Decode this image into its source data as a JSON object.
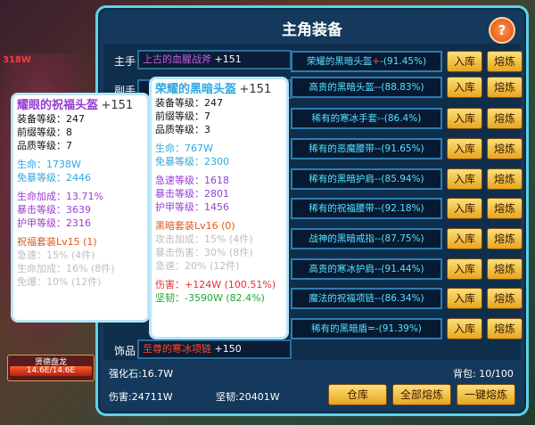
{
  "background": {
    "hp_label": "贤德盘龙",
    "hp_value": "14.6E/14.6E",
    "red_tag": "318W"
  },
  "panel": {
    "title": "主角装备",
    "help_icon": "?"
  },
  "slots": [
    {
      "label": "主手",
      "name": "上古的血腥战斧",
      "level": "+151",
      "color": "#c85ae6"
    },
    {
      "label": "副手",
      "name": "",
      "level": "",
      "color": "#c85ae6"
    },
    {
      "label": "饰品",
      "name": "至尊的寒冰项链",
      "level": "+150",
      "color": "#ff4a2a"
    }
  ],
  "bag": [
    {
      "name": "荣耀的黑暗头盔",
      "suffix": "+",
      "rate": "-(91.45%)",
      "color": "#57e0ff",
      "store": "入库",
      "smelt": "熔炼"
    },
    {
      "name": "高贵的黑暗头盔",
      "suffix": "",
      "rate": "--(88.83%)",
      "color": "#57e0ff",
      "store": "入库",
      "smelt": "熔炼"
    },
    {
      "name": "稀有的寒冰手套",
      "suffix": "",
      "rate": "--(86.4%)",
      "color": "#57e0ff",
      "store": "入库",
      "smelt": "熔炼"
    },
    {
      "name": "稀有的恶魔腰带",
      "suffix": "",
      "rate": "--(91.65%)",
      "color": "#57e0ff",
      "store": "入库",
      "smelt": "熔炼"
    },
    {
      "name": "稀有的黑暗护肩",
      "suffix": "",
      "rate": "--(85.94%)",
      "color": "#57e0ff",
      "store": "入库",
      "smelt": "熔炼"
    },
    {
      "name": "稀有的祝福腰带",
      "suffix": "",
      "rate": "--(92.18%)",
      "color": "#57e0ff",
      "store": "入库",
      "smelt": "熔炼"
    },
    {
      "name": "战神的黑暗戒指",
      "suffix": "",
      "rate": "--(87.75%)",
      "color": "#57e0ff",
      "store": "入库",
      "smelt": "熔炼"
    },
    {
      "name": "高贵的寒冰护肩",
      "suffix": "",
      "rate": "--(91.44%)",
      "color": "#57e0ff",
      "store": "入库",
      "smelt": "熔炼"
    },
    {
      "name": "魔法的祝福项链",
      "suffix": "",
      "rate": "--(86.34%)",
      "color": "#57e0ff",
      "store": "入库",
      "smelt": "熔炼"
    },
    {
      "name": "稀有的黑暗盾",
      "suffix": "",
      "rate": "=-(91.39%)",
      "color": "#57e0ff",
      "store": "入库",
      "smelt": "熔炼"
    }
  ],
  "footer": {
    "strengthen_stone": "强化石:16.7W",
    "bag_count": "背包: 10/100",
    "damage": "伤害:24711W",
    "toughness": "坚韧:20401W",
    "warehouse_btn": "仓库",
    "smelt_all_btn": "全部熔炼",
    "one_key_smelt_btn": "一键熔炼"
  },
  "tooltip_left": {
    "name": "耀眼的祝福头盔",
    "level": "+151",
    "equip_level": "装备等级：247",
    "prefix_level": "前缀等级：8",
    "quality_level": "品质等级：7",
    "hp": "生命：1738W",
    "dodge": "免暴等级：2446",
    "hp_add": "生命加成：13.71%",
    "crit": "暴击等级：3639",
    "armor": "护甲等级：2316",
    "set_name": "祝福套装Lv15 (1)",
    "set1": "急速：15% (4件)",
    "set2": "生命加成：16% (8件)",
    "set3": "免爆：10% (12件)"
  },
  "tooltip_right": {
    "name": "荣耀的黑暗头盔",
    "level": "+151",
    "equip_level": "装备等级：247",
    "prefix_level": "前缀等级：7",
    "quality_level": "品质等级：3",
    "hp": "生命：767W",
    "dodge": "免暴等级：2300",
    "haste": "急速等级：1618",
    "crit": "暴击等级：2801",
    "armor": "护甲等级：1456",
    "set_name": "黑暗套装Lv16 (0)",
    "set1": "攻击加成：15% (4件)",
    "set2": "暴击伤害：30% (8件)",
    "set3": "急速：20% (12件)",
    "damage": "伤害：+124W (100.51%)",
    "toughness": "坚韧：-3590W (82.4%)"
  },
  "colors": {
    "panel_border": "#5fd2e8",
    "button_gold": "#f2c23a",
    "cyan_text": "#57e0ff",
    "purple_text": "#9a3bd6"
  }
}
